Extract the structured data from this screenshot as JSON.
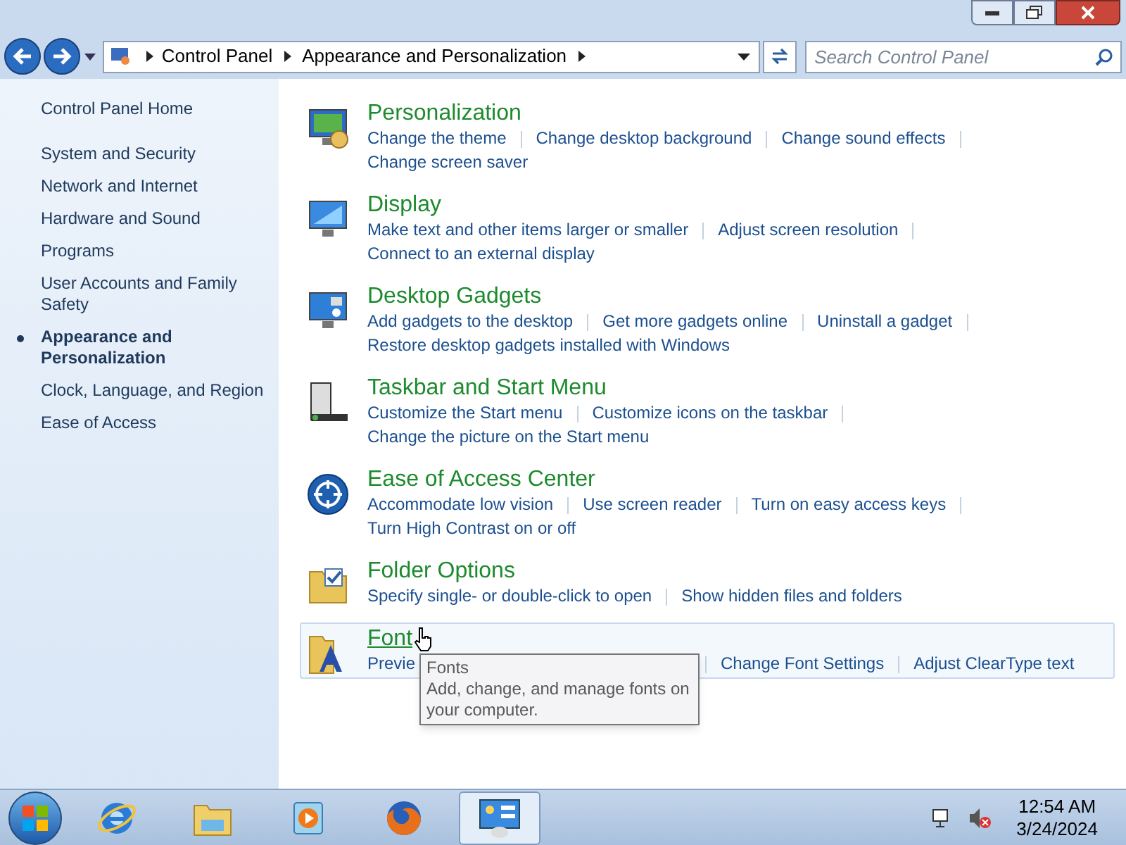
{
  "address_bar": {
    "breadcrumbs": [
      "Control Panel",
      "Appearance and Personalization"
    ]
  },
  "search": {
    "placeholder": "Search Control Panel"
  },
  "sidebar": {
    "home": "Control Panel Home",
    "items": [
      {
        "label": "System and Security",
        "selected": false
      },
      {
        "label": "Network and Internet",
        "selected": false
      },
      {
        "label": "Hardware and Sound",
        "selected": false
      },
      {
        "label": "Programs",
        "selected": false
      },
      {
        "label": "User Accounts and Family Safety",
        "selected": false
      },
      {
        "label": "Appearance and Personalization",
        "selected": true
      },
      {
        "label": "Clock, Language, and Region",
        "selected": false
      },
      {
        "label": "Ease of Access",
        "selected": false
      }
    ]
  },
  "categories": [
    {
      "kind": "personalization",
      "title": "Personalization",
      "hovered": false,
      "links": [
        "Change the theme",
        "Change desktop background",
        "Change sound effects",
        "Change screen saver"
      ]
    },
    {
      "kind": "display",
      "title": "Display",
      "hovered": false,
      "links": [
        "Make text and other items larger or smaller",
        "Adjust screen resolution",
        "Connect to an external display"
      ]
    },
    {
      "kind": "gadgets",
      "title": "Desktop Gadgets",
      "hovered": false,
      "links": [
        "Add gadgets to the desktop",
        "Get more gadgets online",
        "Uninstall a gadget",
        "Restore desktop gadgets installed with Windows"
      ]
    },
    {
      "kind": "taskbar",
      "title": "Taskbar and Start Menu",
      "hovered": false,
      "links": [
        "Customize the Start menu",
        "Customize icons on the taskbar",
        "Change the picture on the Start menu"
      ]
    },
    {
      "kind": "ease",
      "title": "Ease of Access Center",
      "hovered": false,
      "links": [
        "Accommodate low vision",
        "Use screen reader",
        "Turn on easy access keys",
        "Turn High Contrast on or off"
      ]
    },
    {
      "kind": "folder",
      "title": "Folder Options",
      "hovered": false,
      "links": [
        "Specify single- or double-click to open",
        "Show hidden files and folders"
      ]
    },
    {
      "kind": "fonts",
      "title": "Font",
      "hovered": true,
      "links": [
        "Previe",
        "Change Font Settings",
        "Adjust ClearType text"
      ]
    }
  ],
  "tooltip": {
    "title": "Fonts",
    "text": "Add, change, and manage fonts on your computer."
  },
  "taskbar": {
    "apps": [
      {
        "kind": "ie",
        "selected": false
      },
      {
        "kind": "explorer",
        "selected": false
      },
      {
        "kind": "media",
        "selected": false
      },
      {
        "kind": "firefox",
        "selected": false
      },
      {
        "kind": "control",
        "selected": true
      }
    ],
    "time": "12:54 AM",
    "date": "3/24/2024"
  }
}
